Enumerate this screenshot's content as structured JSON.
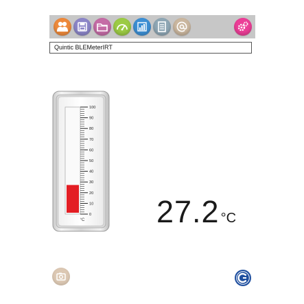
{
  "toolbar": {
    "icons": [
      {
        "name": "people-icon",
        "color": "#ee8a3c"
      },
      {
        "name": "save-icon",
        "color": "#8c86c8"
      },
      {
        "name": "folder-icon",
        "color": "#c56ca6"
      },
      {
        "name": "gauge-icon",
        "color": "#9ccb45"
      },
      {
        "name": "bar-chart-icon",
        "color": "#3d8fd4"
      },
      {
        "name": "document-icon",
        "color": "#8fa7b5"
      },
      {
        "name": "at-sign-icon",
        "color": "#cbb79f"
      },
      {
        "name": "settings-gears-icon",
        "color": "#ec3e97"
      }
    ]
  },
  "device": {
    "name": "Quintic BLEMeterIRT"
  },
  "thermometer": {
    "scale": [
      "100",
      "90",
      "80",
      "70",
      "60",
      "50",
      "40",
      "30",
      "20",
      "10",
      "0"
    ],
    "unit": "°C",
    "fill_value": 27.2,
    "fill_color": "#e31e24"
  },
  "reading": {
    "value": "27.2",
    "unit": "°C"
  },
  "camera": {
    "icon": "camera-icon",
    "color": "#dcc8b3"
  },
  "logo": {
    "icon": "brand-logo-icon",
    "color": "#1f4f9f"
  }
}
